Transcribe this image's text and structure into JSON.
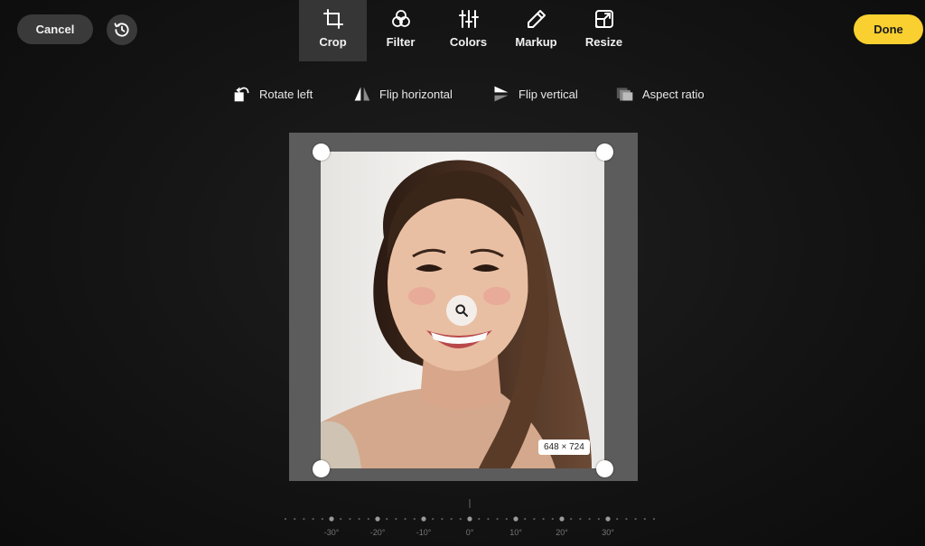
{
  "toolbar": {
    "cancel_label": "Cancel",
    "done_label": "Done",
    "history_icon": "history-icon"
  },
  "tabs": [
    {
      "label": "Crop",
      "icon": "crop-icon",
      "active": true
    },
    {
      "label": "Filter",
      "icon": "filter-icon",
      "active": false
    },
    {
      "label": "Colors",
      "icon": "sliders-icon",
      "active": false
    },
    {
      "label": "Markup",
      "icon": "pen-icon",
      "active": false
    },
    {
      "label": "Resize",
      "icon": "resize-icon",
      "active": false
    }
  ],
  "crop_tools": [
    {
      "label": "Rotate left",
      "icon": "rotate-left-icon"
    },
    {
      "label": "Flip horizontal",
      "icon": "flip-horizontal-icon"
    },
    {
      "label": "Flip vertical",
      "icon": "flip-vertical-icon"
    },
    {
      "label": "Aspect ratio",
      "icon": "aspect-ratio-icon"
    }
  ],
  "canvas": {
    "dimensions_label": "648 × 724",
    "zoom_icon": "search-icon"
  },
  "rotation_ruler": {
    "labels": [
      "-30°",
      "-20°",
      "-10°",
      "0°",
      "10°",
      "20°",
      "30°"
    ],
    "current": "0°"
  },
  "colors": {
    "accent": "#f9d030",
    "active_tab_bg": "#363636"
  }
}
